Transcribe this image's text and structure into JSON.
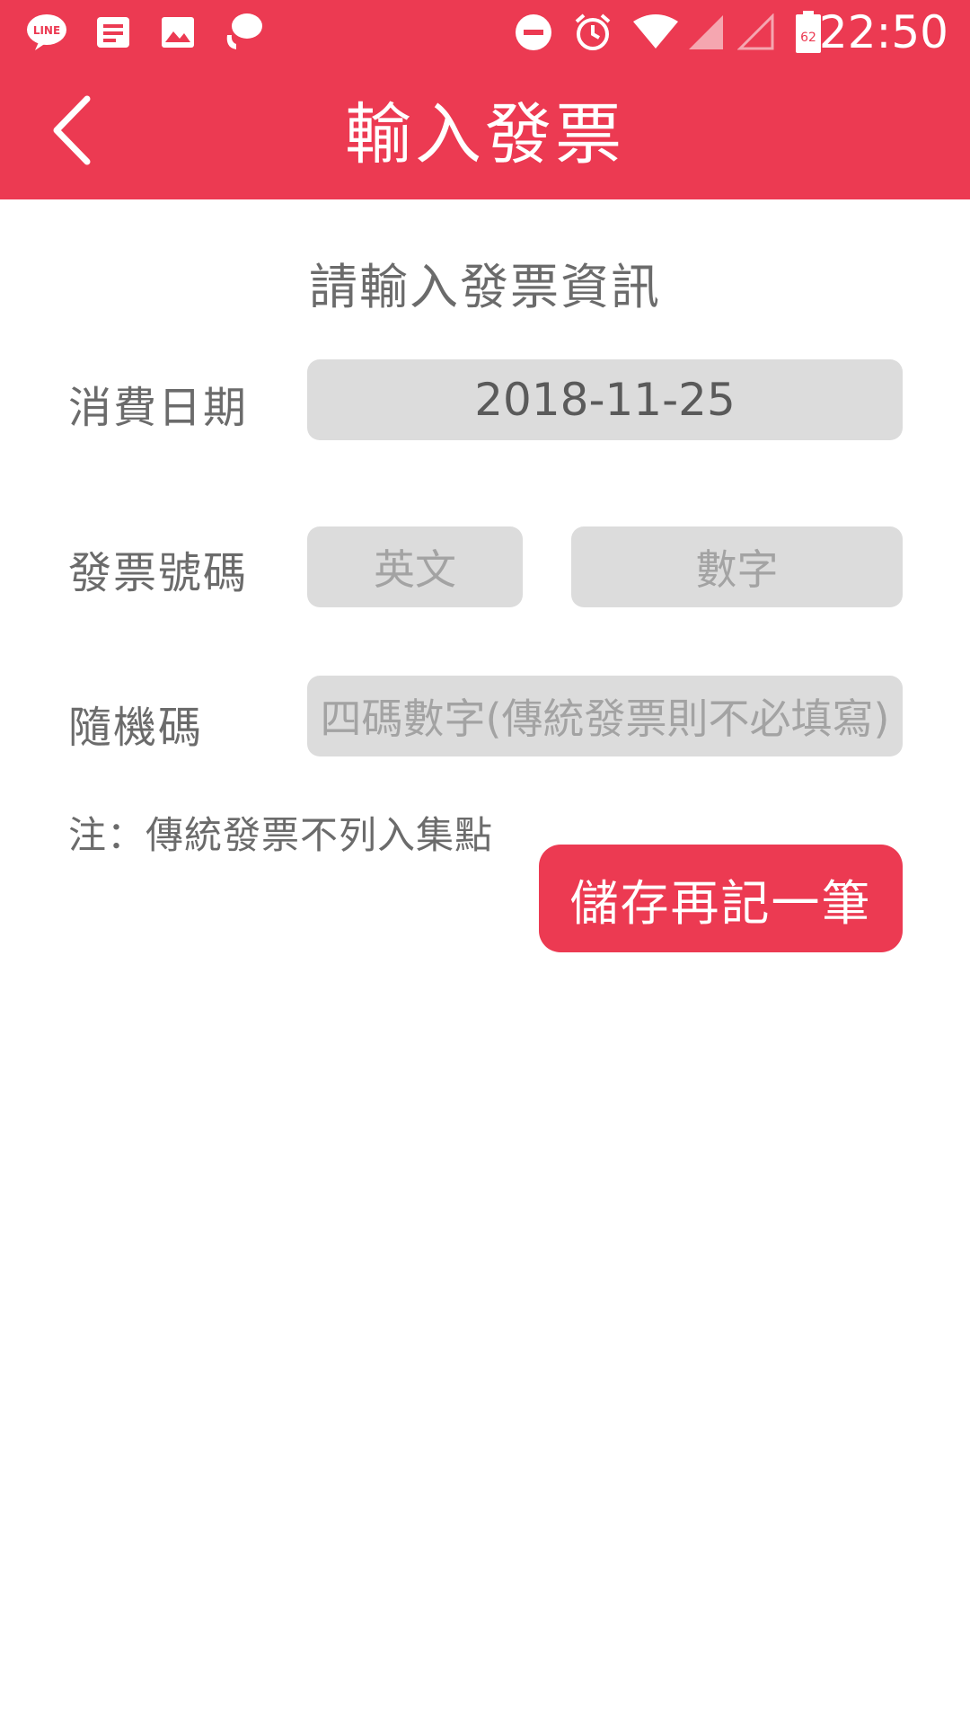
{
  "status_bar": {
    "time": "22:50",
    "battery_level": "62",
    "left_icons": [
      "line-app-icon",
      "note-icon",
      "image-icon",
      "chat-bubble-icon"
    ],
    "right_icons": [
      "do-not-disturb-icon",
      "alarm-icon",
      "wifi-icon",
      "signal-icon",
      "signal-empty-icon",
      "battery-icon"
    ]
  },
  "app_bar": {
    "title": "輸入發票",
    "back_icon": "chevron-left-icon"
  },
  "form": {
    "heading": "請輸入發票資訊",
    "date_label": "消費日期",
    "date_value": "2018-11-25",
    "invoice_label": "發票號碼",
    "invoice_letters_placeholder": "英文",
    "invoice_digits_placeholder": "數字",
    "random_code_label": "隨機碼",
    "random_code_placeholder": "四碼數字(傳統發票則不必填寫)",
    "note": "注：傳統發票不列入集點",
    "save_button": "儲存再記一筆"
  },
  "colors": {
    "brand_red": "#ec3a52",
    "field_bg": "#dcdcdc",
    "label_text": "#6b6b6b",
    "placeholder_text": "#a3a3a3"
  }
}
